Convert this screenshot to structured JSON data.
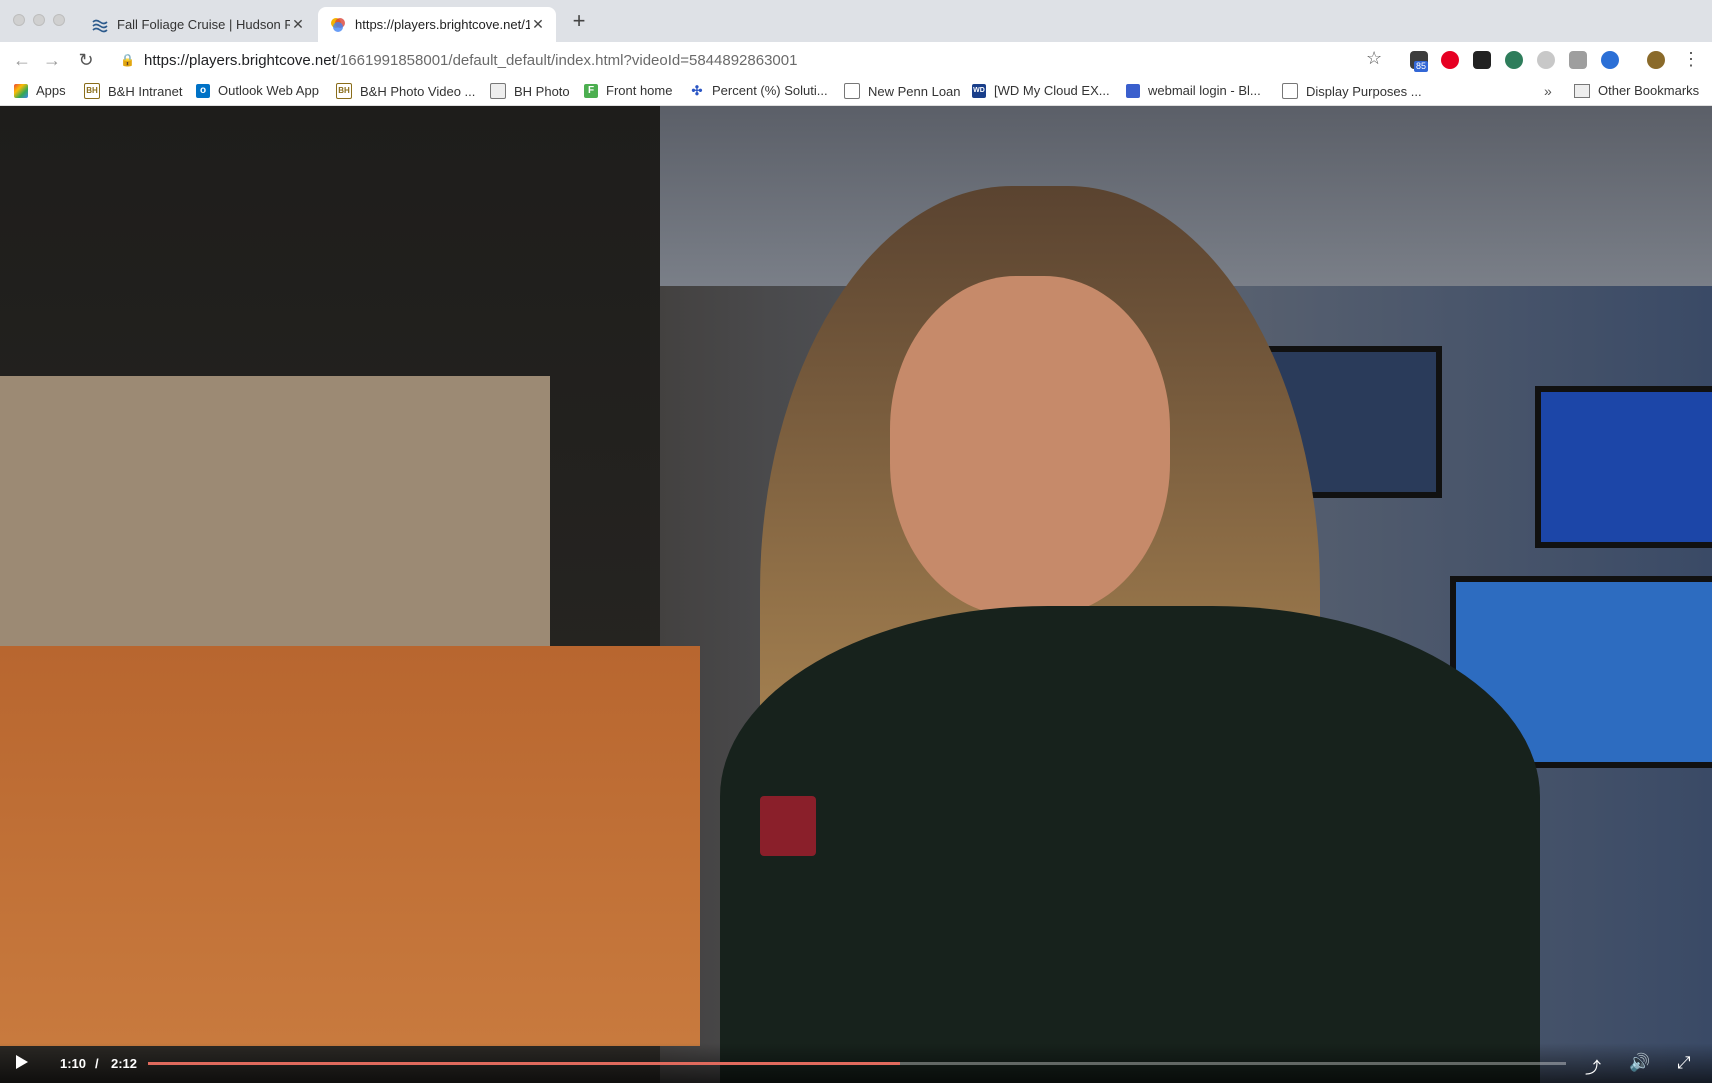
{
  "tabs": [
    {
      "title": "Fall Foliage Cruise | Hudson Ri",
      "active": false
    },
    {
      "title": "https://players.brightcove.net/1",
      "active": true
    }
  ],
  "toolbar": {
    "url_host": "https://players.brightcove.net",
    "url_path": "/1661991858001/default_default/index.html?videoId=5844892863001",
    "extension_badge": "85"
  },
  "bookmarks": {
    "items": [
      {
        "label": "Apps",
        "icon": "apps-grid-icon"
      },
      {
        "label": "B&H Intranet",
        "icon": "bh-icon"
      },
      {
        "label": "Outlook Web App",
        "icon": "outlook-icon"
      },
      {
        "label": "B&H Photo Video ...",
        "icon": "bh-icon"
      },
      {
        "label": "BH Photo",
        "icon": "folder-icon"
      },
      {
        "label": "Front home",
        "icon": "front-icon"
      },
      {
        "label": "Percent (%) Soluti...",
        "icon": "puzzle-icon"
      },
      {
        "label": "New Penn Loan",
        "icon": "page-icon"
      },
      {
        "label": "[WD My Cloud EX...",
        "icon": "wd-icon"
      },
      {
        "label": "webmail login - Bl...",
        "icon": "grid-icon"
      },
      {
        "label": "Display Purposes ...",
        "icon": "page-icon"
      }
    ],
    "more": "»",
    "other": "Other Bookmarks"
  },
  "player": {
    "time_current": "1:10",
    "time_separator": "/",
    "time_duration": "2:12",
    "progress_fraction": 0.53
  },
  "colors": {
    "tabstrip": "#dee1e6",
    "progress": "#e06a5d"
  }
}
